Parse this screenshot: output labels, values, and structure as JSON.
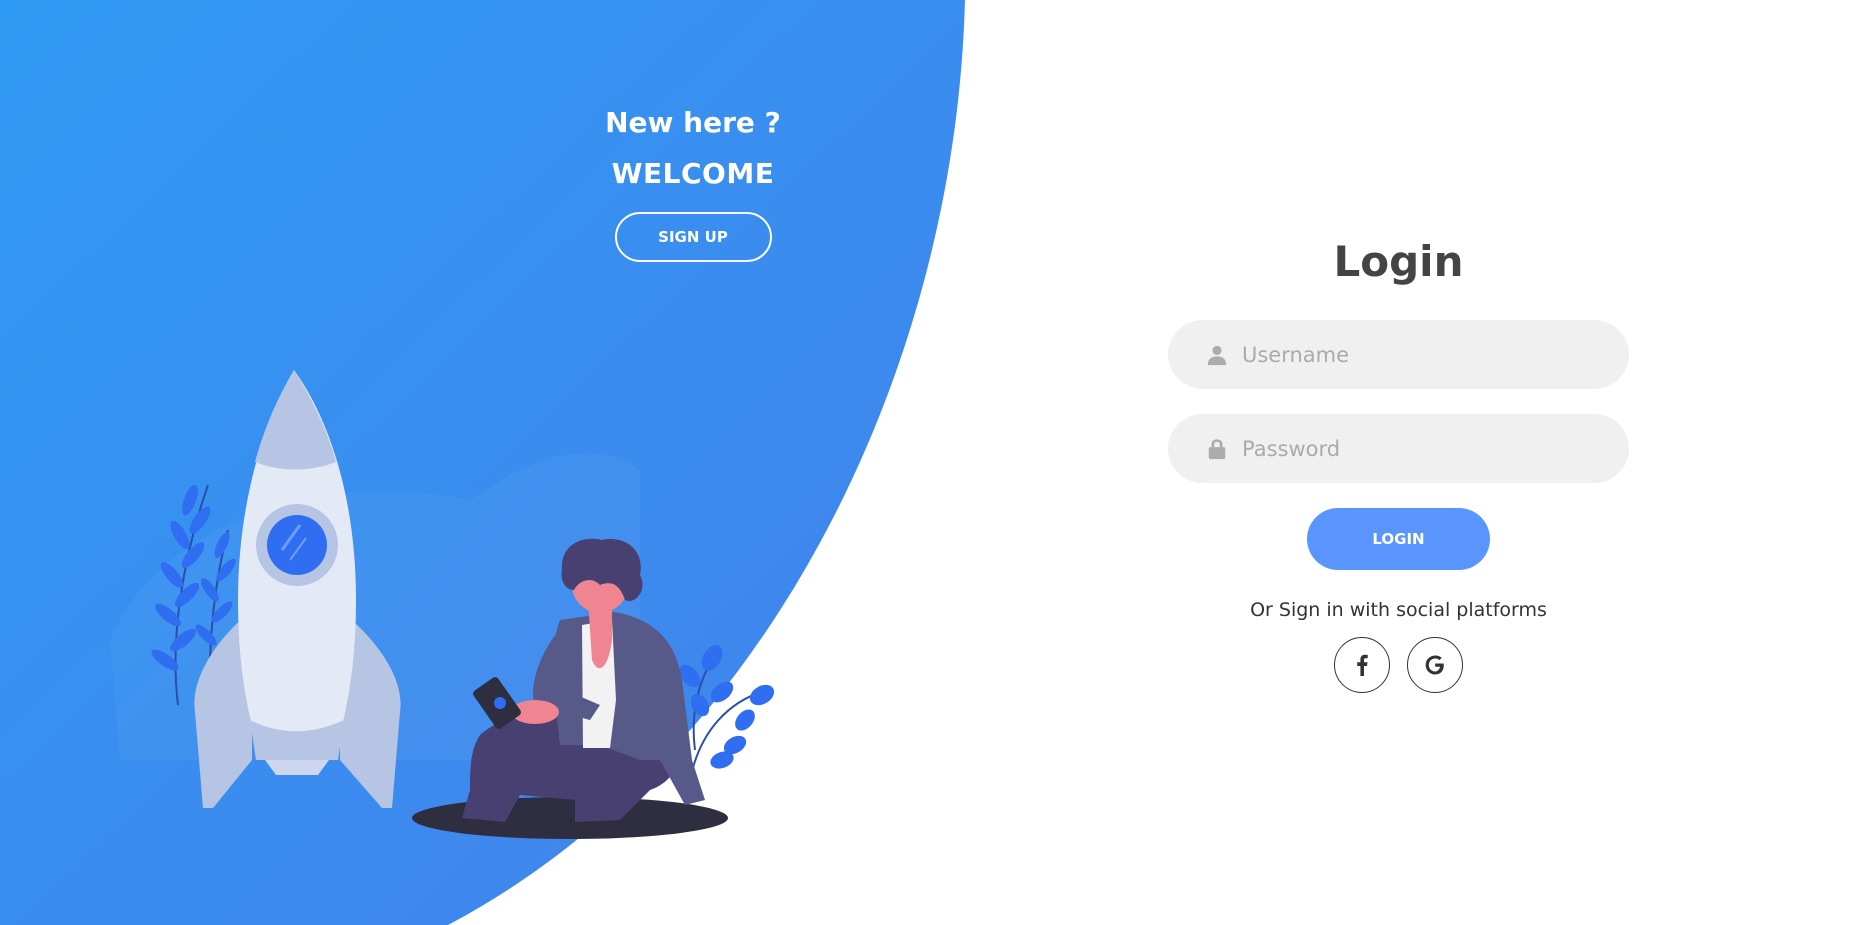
{
  "panel_left": {
    "heading": "New here ?",
    "subheading": "WELCOME",
    "signup_button": "SIGN UP"
  },
  "login_form": {
    "title": "Login",
    "username": {
      "placeholder": "Username",
      "value": "",
      "icon": "user-icon"
    },
    "password": {
      "placeholder": "Password",
      "value": "",
      "icon": "lock-icon"
    },
    "login_button": "LOGIN",
    "social_text": "Or Sign in with social platforms",
    "social_buttons": [
      {
        "icon": "facebook-icon"
      },
      {
        "icon": "google-icon"
      }
    ]
  },
  "colors": {
    "primary_blue": "#4481eb",
    "light_blue": "#2f96f3",
    "button_blue": "#5995fd",
    "input_bg": "#f0f0f0",
    "title_color": "#444444"
  }
}
